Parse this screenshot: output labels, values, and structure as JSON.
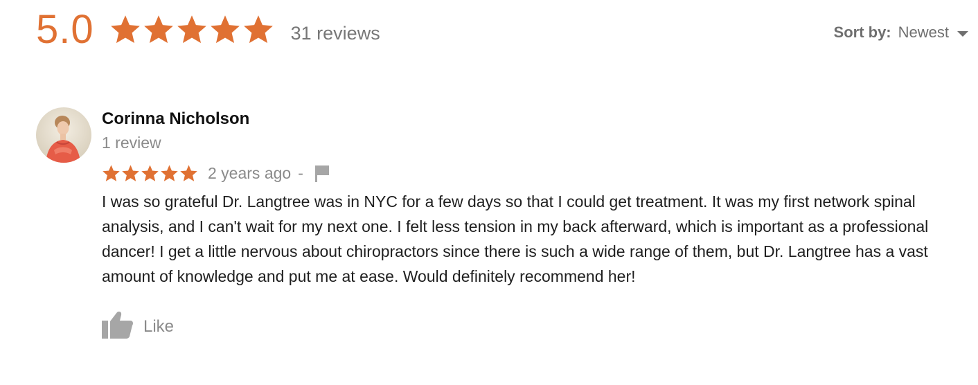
{
  "summary": {
    "score": "5.0",
    "rating": 5,
    "max_rating": 5,
    "review_count": "31 reviews"
  },
  "sort": {
    "label": "Sort by:",
    "value": "Newest"
  },
  "review": {
    "reviewer_name": "Corinna Nicholson",
    "reviewer_reviews": "1 review",
    "rating": 5,
    "time": "2 years ago",
    "separator": "-",
    "text": "I was so grateful Dr. Langtree was in NYC for a few days so that I could get treatment. It was my first network spinal analysis, and I can't wait for my next one. I felt less tension in my back afterward, which is important as a professional dancer! I get a little nervous about chiropractors since there is such a wide range of them, but Dr. Langtree has a vast amount of knowledge and put me at ease. Would definitely recommend her!",
    "like_label": "Like"
  },
  "icons": {
    "star": "star-icon",
    "flag": "flag-icon",
    "thumbs_up": "thumbs-up-icon",
    "caret": "chevron-down-icon"
  },
  "colors": {
    "accent": "#e07133",
    "muted": "#8a8a8a",
    "icon_gray": "#a6a6a6"
  }
}
